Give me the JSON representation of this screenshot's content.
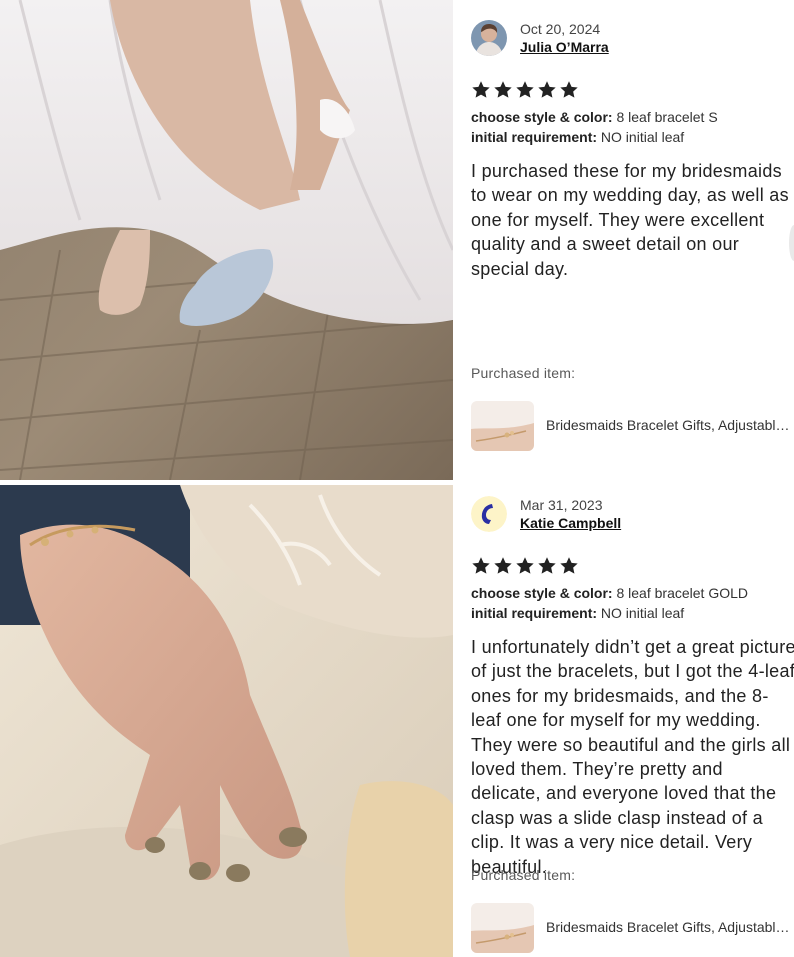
{
  "reviews": [
    {
      "date": "Oct 20, 2024",
      "reviewer": "Julia O’Marra",
      "rating": 5,
      "style_label": "choose style & color:",
      "style_value": "8 leaf bracelet S",
      "initial_label": "initial requirement:",
      "initial_value": "NO initial leaf",
      "text": "I purchased these for my bridesmaids to wear on my wedding day, as well as one for myself. They were excellent quality and a sweet detail on our special day.",
      "purchased_label": "Purchased item:",
      "item_title": "Bridesmaids Bracelet Gifts, Adjustable Leaf Bracelet"
    },
    {
      "date": "Mar 31, 2023",
      "reviewer": "Katie Campbell",
      "rating": 5,
      "style_label": "choose style & color:",
      "style_value": "8 leaf bracelet GOLD",
      "initial_label": "initial requirement:",
      "initial_value": "NO initial leaf",
      "text": "I unfortunately didn’t get a great picture of just the bracelets, but I got the 4-leaf ones for my bridesmaids, and the 8-leaf one for myself for my wedding. They were so beautiful and the girls all loved them. They’re pretty and delicate, and everyone loved that the clasp was a slide clasp instead of a clip. It was a very nice detail. Very beautiful.",
      "purchased_label": "Purchased item:",
      "item_title": "Bridesmaids Bracelet Gifts, Adjustable Leaf Bracelet"
    }
  ],
  "colors": {
    "star": "#222222",
    "text": "#222222",
    "muted": "#595959"
  },
  "icons": {
    "star": "star-icon"
  }
}
